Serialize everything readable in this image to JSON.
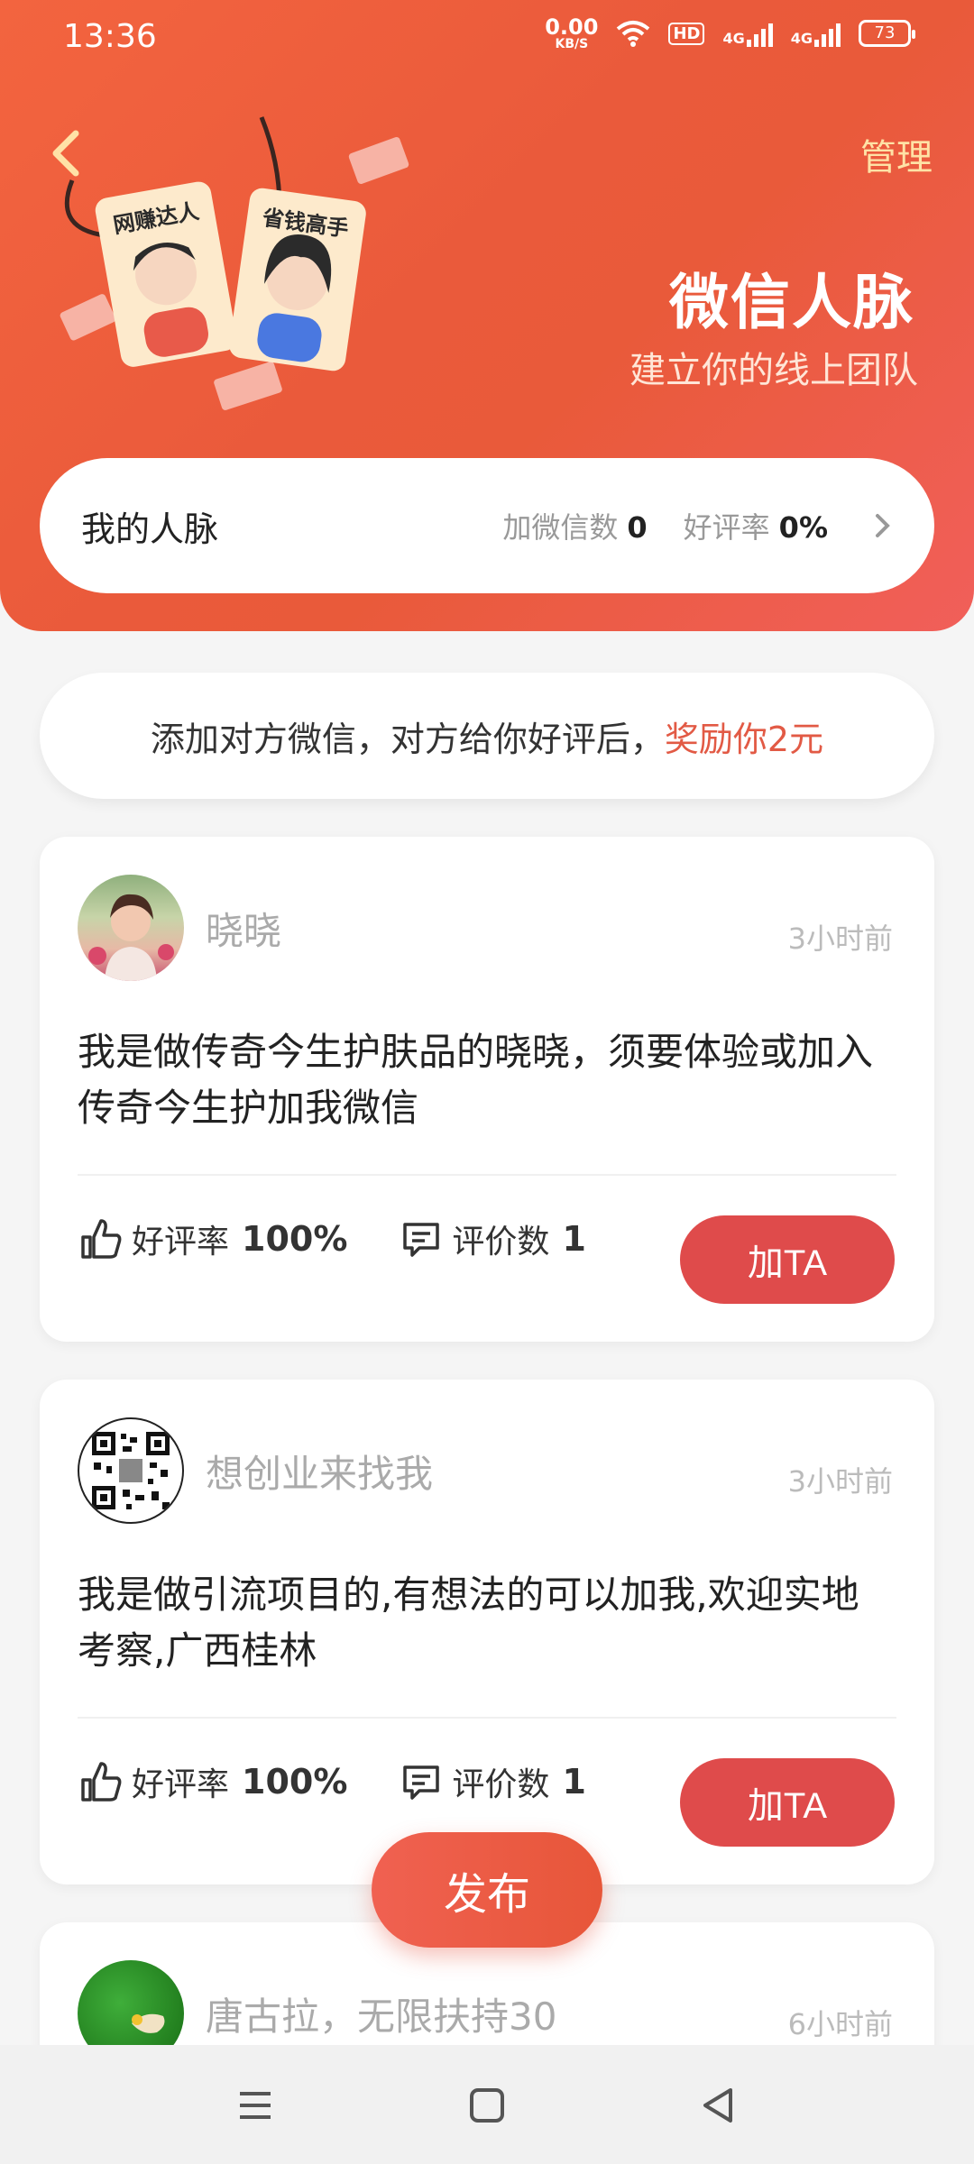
{
  "status_bar": {
    "time": "13:36",
    "net_speed_value": "0.00",
    "net_speed_unit": "KB/S",
    "hd_label": "HD",
    "sim1_label": "4G",
    "sim2_label": "4G",
    "battery": "73"
  },
  "header": {
    "manage_label": "管理",
    "title": "微信人脉",
    "subtitle": "建立你的线上团队",
    "illustration_tag_left": "网赚达人",
    "illustration_tag_right": "省钱高手"
  },
  "summary": {
    "title": "我的人脉",
    "wechat_added_label": "加微信数",
    "wechat_added_value": "0",
    "rating_label": "好评率",
    "rating_value": "0%"
  },
  "notice": {
    "text": "添加对方微信，对方给你好评后，",
    "reward": "奖励你2元"
  },
  "cards": [
    {
      "name": "晓晓",
      "time": "3小时前",
      "content": "我是做传奇今生护肤品的晓晓，须要体验或加入传奇今生护加我微信",
      "rating_label": "好评率",
      "rating_value": "100%",
      "reviews_label": "评价数",
      "reviews_value": "1",
      "button": "加TA"
    },
    {
      "name": "想创业来找我",
      "time": "3小时前",
      "content": "我是做引流项目的,有想法的可以加我,欢迎实地考察,广西桂林",
      "rating_label": "好评率",
      "rating_value": "100%",
      "reviews_label": "评价数",
      "reviews_value": "1",
      "button": "加TA"
    },
    {
      "name": "唐古拉，无限扶持30",
      "time": "6小时前"
    }
  ],
  "publish_button": "发布",
  "colors": {
    "brand": "#e95a3a",
    "button": "#df4b4b",
    "reward_text": "#e25a45",
    "manage_text": "#ffe2a6"
  },
  "icons": [
    "back-icon",
    "chevron-right-icon",
    "thumbs-up-icon",
    "comment-icon",
    "menu-icon",
    "home-icon",
    "back-triangle-icon"
  ]
}
